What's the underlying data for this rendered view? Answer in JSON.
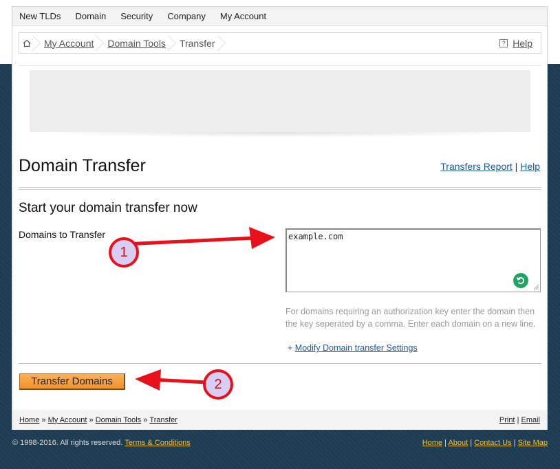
{
  "topnav": [
    "New TLDs",
    "Domain",
    "Security",
    "Company",
    "My Account"
  ],
  "breadcrumb": {
    "items": [
      "My Account",
      "Domain Tools",
      "Transfer"
    ],
    "help": "Help"
  },
  "page": {
    "title": "Domain Transfer",
    "links": {
      "report": "Transfers Report",
      "sep": "|",
      "help": "Help"
    },
    "subtitle": "Start your domain transfer now"
  },
  "form": {
    "label": "Domains to Transfer",
    "value": "example.com",
    "hint": "For domains requiring an authorization key enter the domain then the key seperated by a comma. Enter each domain on a new line.",
    "modify_prefix": "+",
    "modify_link": "Modify Domain transfer Settings",
    "submit": "Transfer Domains"
  },
  "footer": {
    "crumbs": [
      "Home",
      "My Account",
      "Domain Tools",
      "Transfer"
    ],
    "crumb_sep": "»",
    "print": "Print",
    "email": "Email",
    "sep": "|"
  },
  "bottom": {
    "copyright": "© 1998-2016. All rights reserved.",
    "terms": "Terms & Conditions",
    "links": [
      "Home",
      "About",
      "Contact Us",
      "Site Map"
    ]
  },
  "annotations": {
    "badge1": "1",
    "badge2": "2",
    "color": "#e8101a"
  }
}
